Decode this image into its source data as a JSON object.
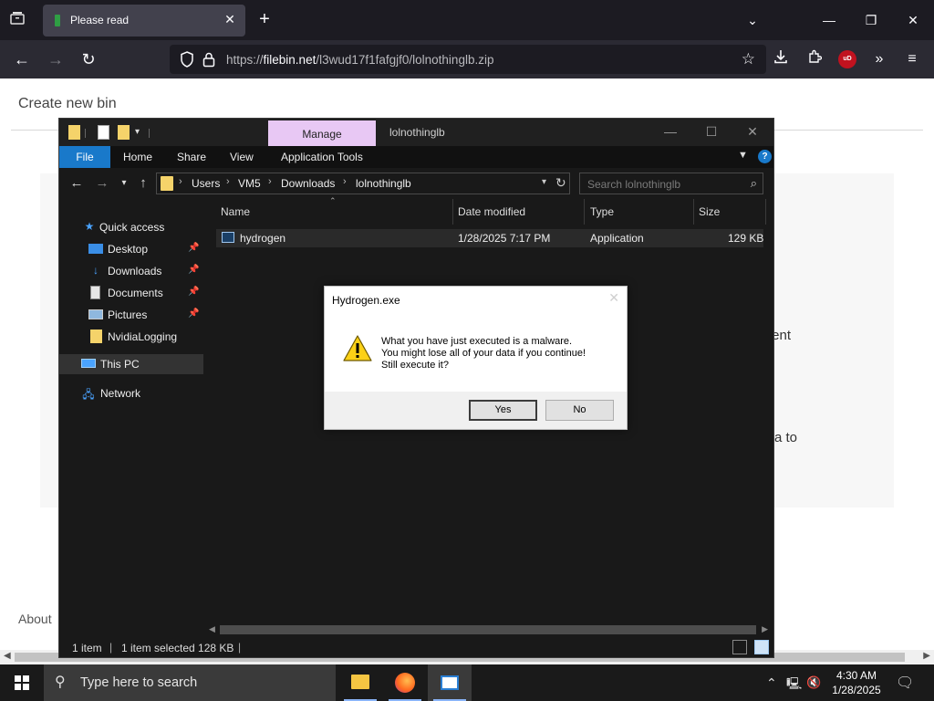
{
  "browser": {
    "tab": {
      "title": "Please read"
    },
    "url": {
      "prefix": "https://",
      "host": "filebin.net",
      "path": "/l3wud17f1fafgjf0/lolnothinglb.zip"
    },
    "ublock_label": "uD"
  },
  "page": {
    "title": "Create new bin",
    "frag1": "tent",
    "frag2": "a to",
    "about": "About"
  },
  "explorer": {
    "title": "lolnothinglb",
    "manage_tab": "Manage",
    "ribbon": [
      "File",
      "Home",
      "Share",
      "View",
      "Application Tools"
    ],
    "breadcrumbs": [
      "Users",
      "VM5",
      "Downloads",
      "lolnothinglb"
    ],
    "search_placeholder": "Search lolnothinglb",
    "nav": [
      {
        "label": "Quick access",
        "icon": "star-icon",
        "pinned": false
      },
      {
        "label": "Desktop",
        "icon": "desktop-icon",
        "pinned": true
      },
      {
        "label": "Downloads",
        "icon": "downloads-icon",
        "pinned": true
      },
      {
        "label": "Documents",
        "icon": "documents-icon",
        "pinned": true
      },
      {
        "label": "Pictures",
        "icon": "pictures-icon",
        "pinned": true
      },
      {
        "label": "NvidiaLogging",
        "icon": "folder-icon",
        "pinned": false
      },
      {
        "label": "This PC",
        "icon": "computer-icon",
        "pinned": false,
        "selected": true
      },
      {
        "label": "Network",
        "icon": "network-icon",
        "pinned": false
      }
    ],
    "columns": [
      "Name",
      "Date modified",
      "Type",
      "Size"
    ],
    "files": [
      {
        "name": "hydrogen",
        "date": "1/28/2025 7:17 PM",
        "type": "Application",
        "size": "129 KB"
      }
    ],
    "status": {
      "count": "1 item",
      "selected": "1 item selected  128 KB"
    }
  },
  "dialog": {
    "title": "Hydrogen.exe",
    "message": [
      "What you have just executed is a malware.",
      "You might lose all of your data if you continue!",
      "Still execute it?"
    ],
    "yes": "Yes",
    "no": "No"
  },
  "taskbar": {
    "search_placeholder": "Type here to search",
    "time": "4:30 AM",
    "date": "1/28/2025"
  },
  "colors": {
    "accent": "#1979ca",
    "manage_tab": "#e8c8f4",
    "explorer_bg": "#191919"
  }
}
